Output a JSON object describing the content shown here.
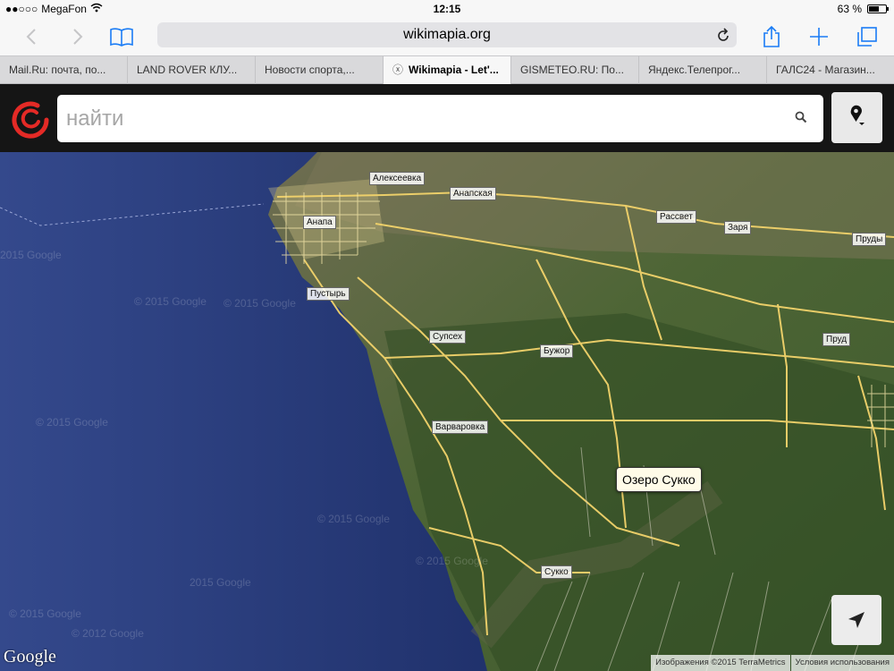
{
  "status_bar": {
    "signal": "●●○○○",
    "carrier": "MegaFon",
    "wifi_icon": "wifi-icon",
    "time": "12:15",
    "battery_text": "63 %",
    "battery_level": 0.63
  },
  "browser": {
    "back_icon": "chevron-left-icon",
    "forward_icon": "chevron-right-icon",
    "bookmarks_icon": "book-icon",
    "url": "wikimapia.org",
    "reload_icon": "reload-icon",
    "share_icon": "share-icon",
    "new_tab_icon": "plus-icon",
    "tabs_icon": "tabs-icon",
    "tabs": [
      {
        "label": "Mail.Ru: почта, по..."
      },
      {
        "label": "LAND ROVER КЛУ..."
      },
      {
        "label": "Новости спорта,..."
      },
      {
        "label": "Wikimapia - Let'...",
        "active": true
      },
      {
        "label": "GISMETEO.RU: По..."
      },
      {
        "label": "Яндекс.Телепрог..."
      },
      {
        "label": "ГАЛС24 - Магазин..."
      }
    ]
  },
  "wikimapia": {
    "logo_icon": "wikimapia-logo-icon",
    "search_placeholder": "найти",
    "search_icon": "search-icon",
    "location_pin_icon": "location-pin-icon"
  },
  "map": {
    "places": [
      {
        "label": "Алексеевка"
      },
      {
        "label": "Анапская"
      },
      {
        "label": "Анапа"
      },
      {
        "label": "Рассвет"
      },
      {
        "label": "Заря"
      },
      {
        "label": "Пруды"
      },
      {
        "label": "Пустырь"
      },
      {
        "label": "Супсех"
      },
      {
        "label": "Бужор"
      },
      {
        "label": "Пруд"
      },
      {
        "label": "Варваровка"
      },
      {
        "label": "Сукко"
      }
    ],
    "callout": "Озеро Сукко",
    "watermark": "© 2015 Google",
    "watermark_2012": "© 2012 Google",
    "watermark_year": "2015 Google",
    "google_logo": "Google",
    "attribution_imagery": "Изображения ©2015 TerraMetrics",
    "attribution_terms": "Условия использования",
    "locate_icon": "navigation-arrow-icon"
  },
  "colors": {
    "accent": "#1a7cf5",
    "logo_red": "#e42a26",
    "road_yellow": "#f2d36b",
    "sea": "#20306a",
    "land": "#4d6a35"
  }
}
